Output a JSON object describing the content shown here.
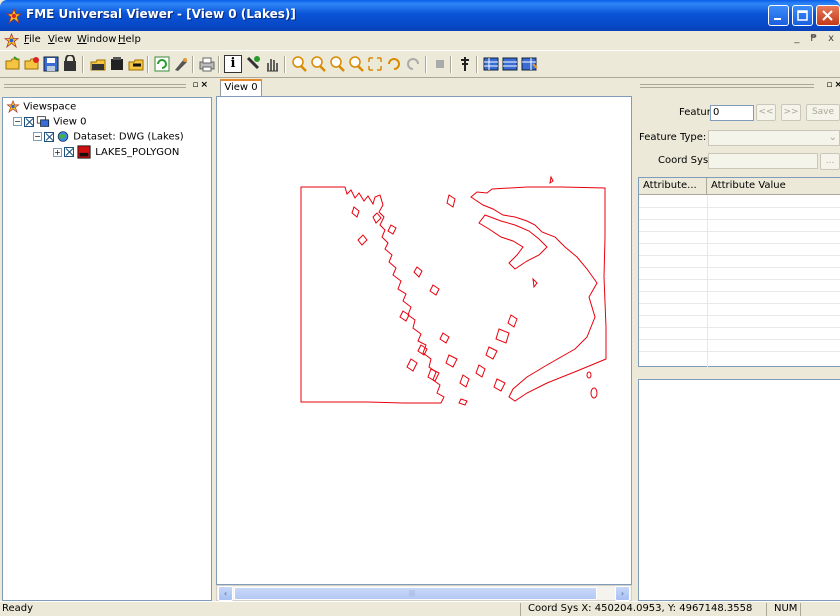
{
  "window": {
    "title": "FME Universal Viewer - [View 0 (Lakes)]"
  },
  "menu": {
    "items": [
      "File",
      "View",
      "Window",
      "Help"
    ],
    "mdi_controls": "_ ₱ x"
  },
  "toolbar": {
    "identify_label": "i"
  },
  "left_panel": {
    "tree": [
      {
        "label": "Viewspace",
        "icon": "viewspace-icon",
        "depth": 0
      },
      {
        "label": "View 0",
        "icon": "view-icon",
        "depth": 1,
        "expander": "⊟"
      },
      {
        "label": "Dataset: DWG (Lakes)",
        "icon": "dataset-icon",
        "depth": 2,
        "expander": "⊟"
      },
      {
        "label": "LAKES_POLYGON",
        "icon": "layer-icon",
        "depth": 3,
        "expander": "⊞"
      }
    ]
  },
  "center": {
    "tab_label": "View 0",
    "feature_color": "#e8000d",
    "scroll_left": "‹",
    "scroll_right": "›",
    "scroll_grip": "|||"
  },
  "right_panel": {
    "feature_label": "Feature:",
    "feature_value": "0",
    "prev_btn": "<<",
    "next_btn": ">>",
    "save_btn": "Save",
    "feature_type_label": "Feature Type:",
    "coord_sys_label": "Coord Sys:",
    "coord_btn": "...",
    "table_headers": [
      "Attribute...",
      "Attribute Value"
    ]
  },
  "status": {
    "ready": "Ready",
    "coords": "Coord Sys  X: 450204.0953, Y: 4967148.3558",
    "num": "NUM"
  }
}
